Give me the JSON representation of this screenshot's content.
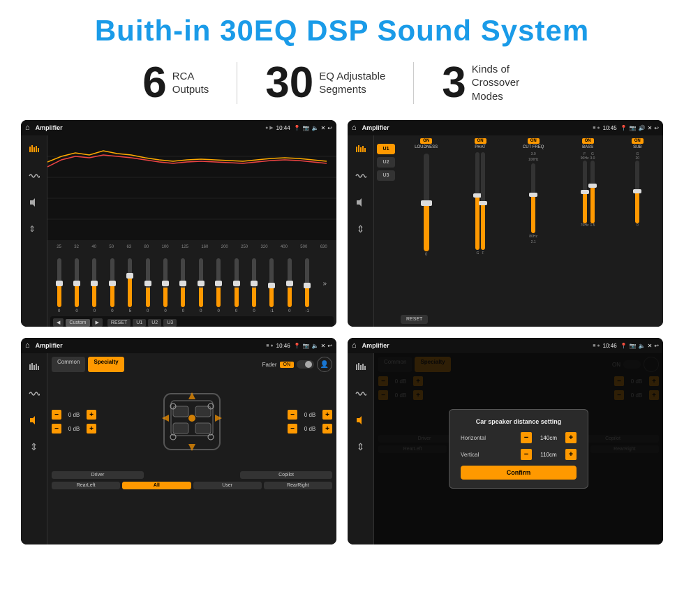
{
  "page": {
    "title": "Buith-in 30EQ DSP Sound System",
    "stats": [
      {
        "number": "6",
        "label": "RCA\nOutputs"
      },
      {
        "number": "30",
        "label": "EQ Adjustable\nSegments"
      },
      {
        "number": "3",
        "label": "Kinds of\nCrossover Modes"
      }
    ],
    "screens": [
      {
        "id": "screen1",
        "app": "Amplifier",
        "time": "10:44",
        "description": "EQ 30-band screen"
      },
      {
        "id": "screen2",
        "app": "Amplifier",
        "time": "10:45",
        "description": "Crossover modes screen"
      },
      {
        "id": "screen3",
        "app": "Amplifier",
        "time": "10:46",
        "description": "Speaker fader common screen"
      },
      {
        "id": "screen4",
        "app": "Amplifier",
        "time": "10:46",
        "description": "Car speaker distance setting"
      }
    ],
    "eq": {
      "freqs": [
        "25",
        "32",
        "40",
        "50",
        "63",
        "80",
        "100",
        "125",
        "160",
        "200",
        "250",
        "320",
        "400",
        "500",
        "630"
      ],
      "values": [
        "0",
        "0",
        "0",
        "0",
        "5",
        "0",
        "0",
        "0",
        "0",
        "0",
        "0",
        "0",
        "-1",
        "0",
        "-1"
      ],
      "preset": "Custom",
      "buttons": [
        "◀",
        "Custom",
        "▶",
        "RESET",
        "U1",
        "U2",
        "U3"
      ]
    },
    "crossover": {
      "presets": [
        "U1",
        "U2",
        "U3"
      ],
      "channels": [
        "LOUDNESS",
        "PHAT",
        "CUT FREQ",
        "BASS",
        "SUB"
      ],
      "on_labels": [
        "ON",
        "ON",
        "ON",
        "ON",
        "ON"
      ],
      "reset": "RESET"
    },
    "fader": {
      "tabs": [
        "Common",
        "Specialty"
      ],
      "active_tab": "Specialty",
      "fader_label": "Fader",
      "on": "ON",
      "volumes": [
        "0 dB",
        "0 dB",
        "0 dB",
        "0 dB"
      ],
      "buttons": [
        "Driver",
        "",
        "Copilot",
        "RearLeft",
        "All",
        "User",
        "RearRight"
      ]
    },
    "distance_modal": {
      "title": "Car speaker distance setting",
      "horizontal_label": "Horizontal",
      "horizontal_value": "140cm",
      "vertical_label": "Vertical",
      "vertical_value": "110cm",
      "confirm": "Confirm"
    }
  }
}
